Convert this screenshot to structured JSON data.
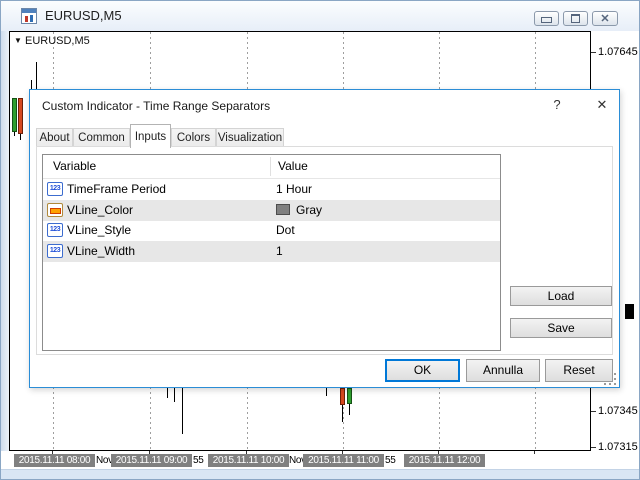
{
  "window": {
    "title": "EURUSD,M5"
  },
  "chart": {
    "symbol_label": "EURUSD,M5",
    "dropdown_arrow": "▼",
    "price_labels": [
      "1.07645",
      "1.07345",
      "1.07315"
    ],
    "time_labels": [
      "2015.11.11 08:00",
      "2015.11.11 09:00",
      "2015.11.11 10:00",
      "2015.11.11 11:00",
      "2015.11.11 12:00"
    ],
    "overlap_labels": [
      "Nov",
      "55",
      "Nov",
      "55"
    ]
  },
  "dialog": {
    "title": "Custom Indicator - Time Range Separators",
    "help_label": "?",
    "close_label": "✕",
    "tabs": [
      {
        "label": "About"
      },
      {
        "label": "Common"
      },
      {
        "label": "Inputs",
        "active": true
      },
      {
        "label": "Colors"
      },
      {
        "label": "Visualization"
      }
    ],
    "table": {
      "headers": [
        "Variable",
        "Value"
      ],
      "icon_123_label": "123",
      "rows": [
        {
          "icon": "numeric-123-icon",
          "variable": "TimeFrame Period",
          "value": "1 Hour"
        },
        {
          "icon": "color-swatch-icon",
          "variable": "VLine_Color",
          "value": "Gray",
          "swatch_color": "#808080"
        },
        {
          "icon": "numeric-123-icon",
          "variable": "VLine_Style",
          "value": "Dot"
        },
        {
          "icon": "numeric-123-icon",
          "variable": "VLine_Width",
          "value": "1"
        }
      ]
    },
    "buttons": {
      "load": "Load",
      "save": "Save",
      "ok": "OK",
      "cancel": "Annulla",
      "reset": "Reset"
    }
  },
  "colors": {
    "dialog_border": "#2b8dd6",
    "ok_border": "#0078d7",
    "candle_up": "#2f9e2f",
    "candle_down": "#d6481d",
    "axis_label_bg": "#808080",
    "swatch_gray": "#808080"
  }
}
